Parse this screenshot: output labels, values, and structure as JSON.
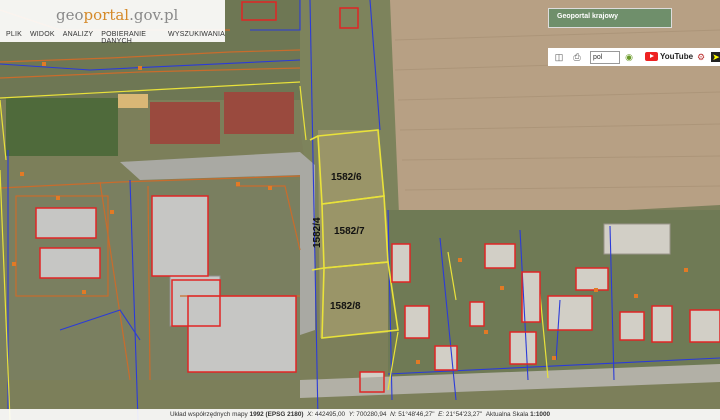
{
  "header": {
    "logo_part1": "geo",
    "logo_part2": "portal",
    "logo_part3": ".gov.pl",
    "menu": [
      "PLIK",
      "WIDOK",
      "ANALIZY",
      "POBIERANIE DANYCH",
      "WYSZUKIWANIA"
    ]
  },
  "regional_button": "Geoportal krajowy",
  "toolbar": {
    "language": "pol",
    "youtube": "YouTube",
    "icons": [
      "save-icon",
      "print-icon",
      "help-icon",
      "gear-icon"
    ]
  },
  "parcels": {
    "p1": "1582/6",
    "p2": "1582/7",
    "p3": "1582/8",
    "p4": "1582/4"
  },
  "status": {
    "coords_label": "Układ współrzędnych mapy",
    "crs": "1992 (EPSG 2180)",
    "x_label": "X:",
    "x_value": "442495,00",
    "y_label": "Y:",
    "y_value": "700280,94",
    "n_label": "N:",
    "n_value": "51°48'46,27\"",
    "e_label": "E:",
    "e_value": "21°54'23,27\"",
    "scale_label": "Aktualna Skala",
    "scale_value": "1:1000"
  },
  "colors": {
    "parcel": "#e9e23a",
    "building": "#e02525",
    "utility": "#2b3bd8",
    "boundary": "#c7672a",
    "field": "#b8a182",
    "grass": "#6f7a48"
  }
}
